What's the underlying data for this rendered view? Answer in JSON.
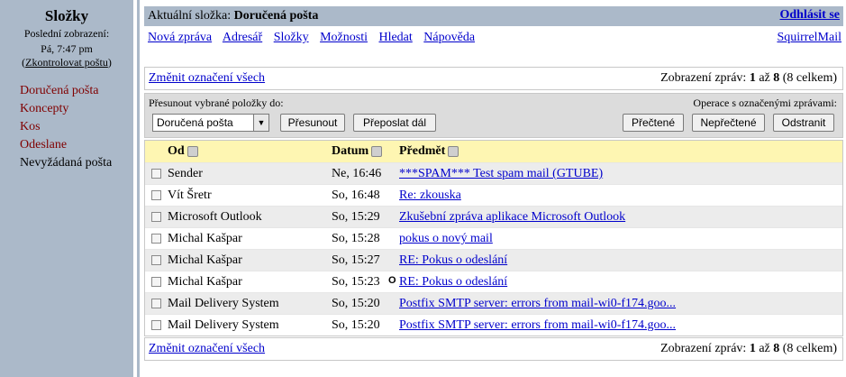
{
  "sidebar": {
    "title": "Složky",
    "last_refresh_label": "Poslední zobrazení:",
    "last_refresh_time": "Pá, 7:47 pm",
    "check_mail_open": "(",
    "check_mail": "Zkontrolovat poštu",
    "check_mail_close": ")",
    "folders": [
      {
        "label": "Doručená pošta"
      },
      {
        "label": "Koncepty"
      },
      {
        "label": "Kos"
      },
      {
        "label": "Odeslane"
      },
      {
        "label": "Nevyžádaná pošta"
      }
    ]
  },
  "topbar": {
    "current_folder_label": "Aktuální složka:",
    "current_folder": "Doručená pošta",
    "logout": "Odhlásit se"
  },
  "menu": {
    "items": [
      "Nová zpráva",
      "Adresář",
      "Složky",
      "Možnosti",
      "Hledat",
      "Nápověda"
    ],
    "brand": "SquirrelMail"
  },
  "paging": {
    "toggle_all": "Změnit označení všech",
    "showing_prefix": "Zobrazení zpráv:",
    "from": "1",
    "to_word": "až",
    "to": "8",
    "total": "(8 celkem)"
  },
  "actions": {
    "move_label": "Přesunout vybrané položky do:",
    "selected_folder": "Doručená pošta",
    "move_button": "Přesunout",
    "forward_button": "Přeposlat dál",
    "marked_label": "Operace s označenými zprávami:",
    "read_button": "Přečtené",
    "unread_button": "Nepřečtené",
    "delete_button": "Odstranit"
  },
  "table": {
    "headers": {
      "from": "Od",
      "date": "Datum",
      "subject": "Předmět"
    },
    "rows": [
      {
        "from": "Sender",
        "date": "Ne, 16:46",
        "flag": "",
        "subject": "***SPAM*** Test spam mail (GTUBE)"
      },
      {
        "from": "Vít Šretr",
        "date": "So, 16:48",
        "flag": "",
        "subject": "Re: zkouska"
      },
      {
        "from": "Microsoft Outlook",
        "date": "So, 15:29",
        "flag": "",
        "subject": "Zkušební zpráva aplikace Microsoft Outlook"
      },
      {
        "from": "Michal Kašpar",
        "date": "So, 15:28",
        "flag": "",
        "subject": "pokus o nový mail"
      },
      {
        "from": "Michal Kašpar",
        "date": "So, 15:27",
        "flag": "",
        "subject": "RE: Pokus o odeslání"
      },
      {
        "from": "Michal Kašpar",
        "date": "So, 15:23",
        "flag": "O",
        "subject": "RE: Pokus o odeslání"
      },
      {
        "from": "Mail Delivery System",
        "date": "So, 15:20",
        "flag": "",
        "subject": "Postfix SMTP server: errors from mail-wi0-f174.goo..."
      },
      {
        "from": "Mail Delivery System",
        "date": "So, 15:20",
        "flag": "",
        "subject": "Postfix SMTP server: errors from mail-wi0-f174.goo..."
      }
    ]
  }
}
